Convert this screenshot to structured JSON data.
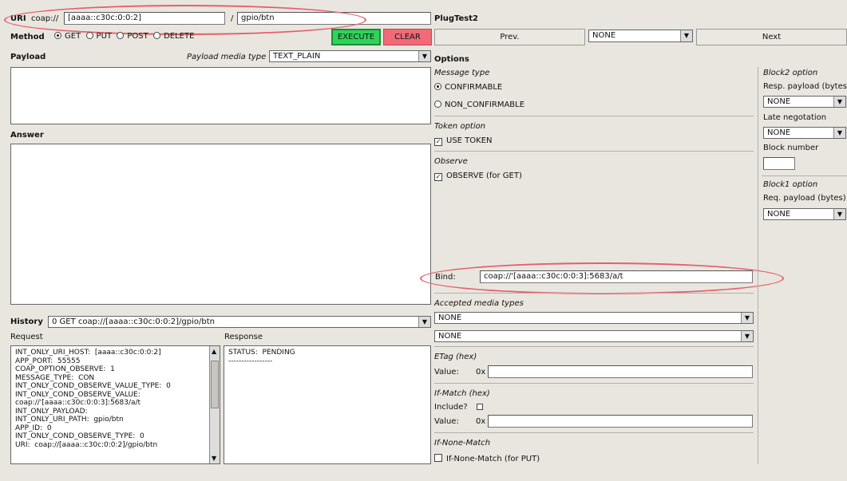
{
  "uri": {
    "label": "URI",
    "scheme": "coap://",
    "host": "[aaaa::c30c:0:0:2]",
    "slash": "/",
    "path": "gpio/btn"
  },
  "method": {
    "label": "Method",
    "options": [
      "GET",
      "PUT",
      "POST",
      "DELETE"
    ],
    "selected": "GET",
    "execute": "EXECUTE",
    "clear": "CLEAR"
  },
  "payload": {
    "label": "Payload",
    "media_label": "Payload media type",
    "media_value": "TEXT_PLAIN"
  },
  "answer": {
    "label": "Answer"
  },
  "history": {
    "label": "History",
    "value": "0 GET coap://[aaaa::c30c:0:0:2]/gpio/btn",
    "request_label": "Request",
    "response_label": "Response",
    "request_text": "INT_ONLY_URI_HOST:  [aaaa::c30c:0:0:2]\nAPP_PORT:  55555\nCOAP_OPTION_OBSERVE:  1\nMESSAGE_TYPE:  CON\nINT_ONLY_COND_OBSERVE_VALUE_TYPE:  0\nINT_ONLY_COND_OBSERVE_VALUE:\ncoap://'[aaaa::c30c:0:0:3]:5683/a/t\nINT_ONLY_PAYLOAD:\nINT_ONLY_URI_PATH:  gpio/btn\nAPP_ID:  0\nINT_ONLY_COND_OBSERVE_TYPE:  0\nURI:  coap://[aaaa::c30c:0:0:2]/gpio/btn",
    "response_text": "STATUS:  PENDING\n-----------------"
  },
  "plugtest": {
    "title": "PlugTest2",
    "prev": "Prev.",
    "select": "NONE",
    "next": "Next"
  },
  "options": {
    "title": "Options",
    "message_type_label": "Message type",
    "confirmable": "CONFIRMABLE",
    "non_confirmable": "NON_CONFIRMABLE",
    "token_label": "Token option",
    "use_token": "USE TOKEN",
    "observe_label": "Observe",
    "observe_check": "OBSERVE (for GET)",
    "bind_label": "Bind:",
    "bind_value": "coap://'[aaaa::c30c:0:0:3]:5683/a/t",
    "accepted_label": "Accepted media types",
    "accepted_1": "NONE",
    "accepted_2": "NONE",
    "etag_label": "ETag (hex)",
    "value_label": "Value:",
    "hex_prefix": "0x",
    "ifmatch_label": "If-Match (hex)",
    "include_label": "Include?",
    "ifnonematch_label": "If-None-Match",
    "ifnonematch_check": "If-None-Match (for PUT)"
  },
  "block2": {
    "title": "Block2 option",
    "resp_payload_label": "Resp. payload (bytes)",
    "resp_payload_value": "NONE",
    "late_label": "Late negotation",
    "late_value": "NONE",
    "block_number_label": "Block number"
  },
  "block1": {
    "title": "Block1 option",
    "req_payload_label": "Req. payload (bytes)",
    "req_payload_value": "NONE"
  },
  "colors": {
    "execute": "#2fd35a",
    "clear": "#f06a78",
    "annotation": "#e4606b",
    "background": "#e9e6df"
  }
}
